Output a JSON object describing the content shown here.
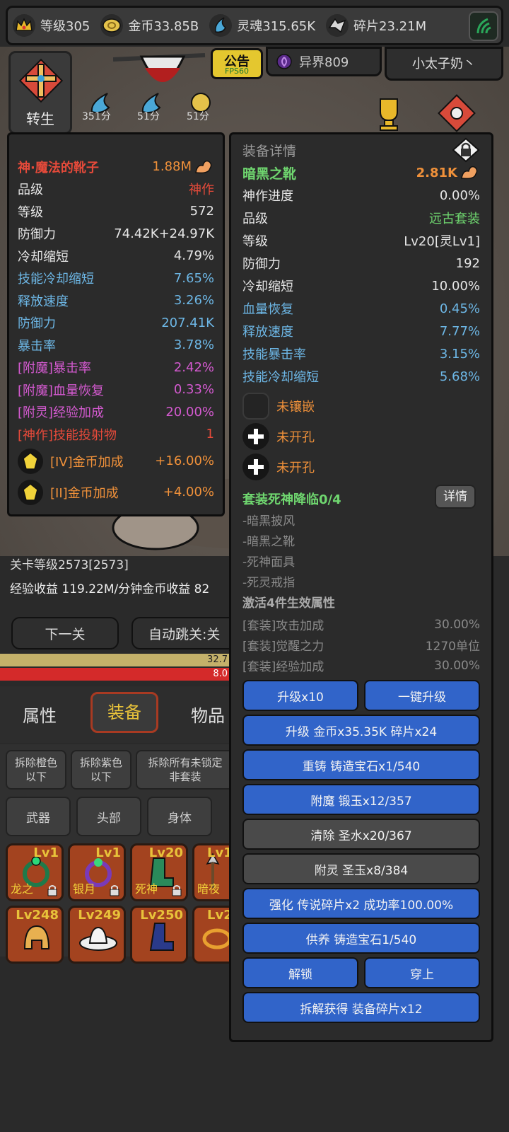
{
  "topbar": {
    "level": "等级305",
    "gold": "金币33.85B",
    "soul": "灵魂315.65K",
    "shards": "碎片23.21M"
  },
  "scene": {
    "notice": "公告",
    "fps": "FPS60",
    "world": "异界809",
    "user": "小太子奶丶",
    "rebirth": "转生",
    "scores": [
      "351分",
      "51分",
      "51分"
    ]
  },
  "left_panel": {
    "name": "神·魔法的靴子",
    "power": "1.88M",
    "rows": [
      {
        "label": "品级",
        "value": "神作"
      },
      {
        "label": "等级",
        "value": "572"
      },
      {
        "label": "防御力",
        "value": "74.42K+24.97K"
      },
      {
        "label": "冷却缩短",
        "value": "4.79%"
      },
      {
        "label": "技能冷却缩短",
        "value": "7.65%"
      },
      {
        "label": "释放速度",
        "value": "3.26%"
      },
      {
        "label": "防御力",
        "value": "207.41K"
      },
      {
        "label": "暴击率",
        "value": "3.78%"
      },
      {
        "label": "[附魔]暴击率",
        "value": "2.42%"
      },
      {
        "label": "[附魔]血量恢复",
        "value": "0.33%"
      },
      {
        "label": "[附灵]经验加成",
        "value": "20.00%"
      },
      {
        "label": "[神作]技能投射物",
        "value": "1"
      }
    ],
    "gems": [
      {
        "label": "[IV]金币加成",
        "value": "+16.00%"
      },
      {
        "label": "[II]金币加成",
        "value": "+4.00%"
      }
    ]
  },
  "right_panel": {
    "header": "装备详情",
    "name": "暗黑之靴",
    "power": "2.81K",
    "rows": [
      {
        "label": "神作进度",
        "value": "0.00%"
      },
      {
        "label": "品级",
        "value": "远古套装"
      },
      {
        "label": "等级",
        "value": "Lv20[灵Lv1]"
      },
      {
        "label": "防御力",
        "value": "192"
      },
      {
        "label": "冷却缩短",
        "value": "10.00%"
      },
      {
        "label": "血量恢复",
        "value": "0.45%"
      },
      {
        "label": "释放速度",
        "value": "7.77%"
      },
      {
        "label": "技能暴击率",
        "value": "3.15%"
      },
      {
        "label": "技能冷却缩短",
        "value": "5.68%"
      }
    ],
    "sockets": [
      "未镶嵌",
      "未开孔",
      "未开孔"
    ],
    "set_title": "套装死神降临0/4",
    "set_detail": "详情",
    "set_items": [
      "-暗黑披风",
      "-暗黑之靴",
      "-死神面具",
      "-死灵戒指"
    ],
    "set_activate": "激活4件生效属性",
    "set_attrs": [
      {
        "label": "[套装]攻击加成",
        "value": "30.00%"
      },
      {
        "label": "[套装]觉醒之力",
        "value": "1270单位"
      },
      {
        "label": "[套装]经验加成",
        "value": "30.00%"
      }
    ],
    "buttons": {
      "upgrade10": "升级x10",
      "upgrade_all": "一键升级",
      "upgrade": "升级 金币x35.35K 碎片x24",
      "recast": "重铸 铸造宝石x1/540",
      "enchant": "附魔 锻玉x12/357",
      "clear": "清除 圣水x20/367",
      "spirit": "附灵 圣玉x8/384",
      "strengthen": "强化 传说碎片x2 成功率100.00%",
      "nurture": "供养 铸造宝石1/540",
      "unlock": "解锁",
      "equip": "穿上",
      "dismantle": "拆解获得 装备碎片x12"
    }
  },
  "bottom": {
    "stage": "关卡等级2573[2573]",
    "income": "经验收益 119.22M/分钟金币收益 82",
    "next": "下一关",
    "auto": "自动跳关:关",
    "bar1": "32.7",
    "bar2": "8.0",
    "tabs": [
      "属性",
      "装备",
      "物品"
    ],
    "filters": [
      "拆除橙色\n以下",
      "拆除紫色\n以下",
      "拆除所有未锁定\n非套装"
    ],
    "slots": [
      "武器",
      "头部",
      "身体"
    ],
    "items_row1": [
      {
        "lv": "Lv1",
        "name": "龙之"
      },
      {
        "lv": "Lv1",
        "name": "银月"
      },
      {
        "lv": "Lv20",
        "name": "死神"
      },
      {
        "lv": "Lv1",
        "name": "暗夜"
      }
    ],
    "items_row2": [
      {
        "lv": "Lv248"
      },
      {
        "lv": "Lv249"
      },
      {
        "lv": "Lv250"
      },
      {
        "lv": "Lv2"
      }
    ]
  }
}
